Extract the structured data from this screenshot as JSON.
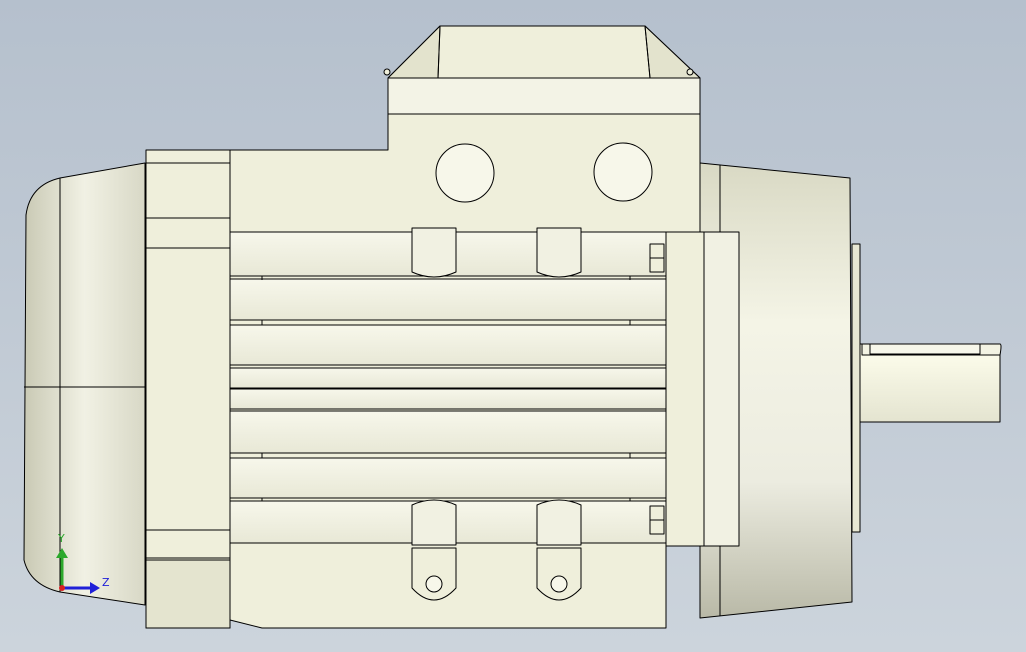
{
  "viewport": {
    "background_top": "#b5c0cd",
    "background_bottom": "#ccd4dc"
  },
  "model": {
    "name": "electric-motor",
    "body_color": "#efefdb",
    "edge_color": "#000000"
  },
  "triad": {
    "y_label": "Y",
    "z_label": "Z",
    "y_color": "#2ca82c",
    "z_color": "#2020d8",
    "x_color": "#d82020"
  }
}
